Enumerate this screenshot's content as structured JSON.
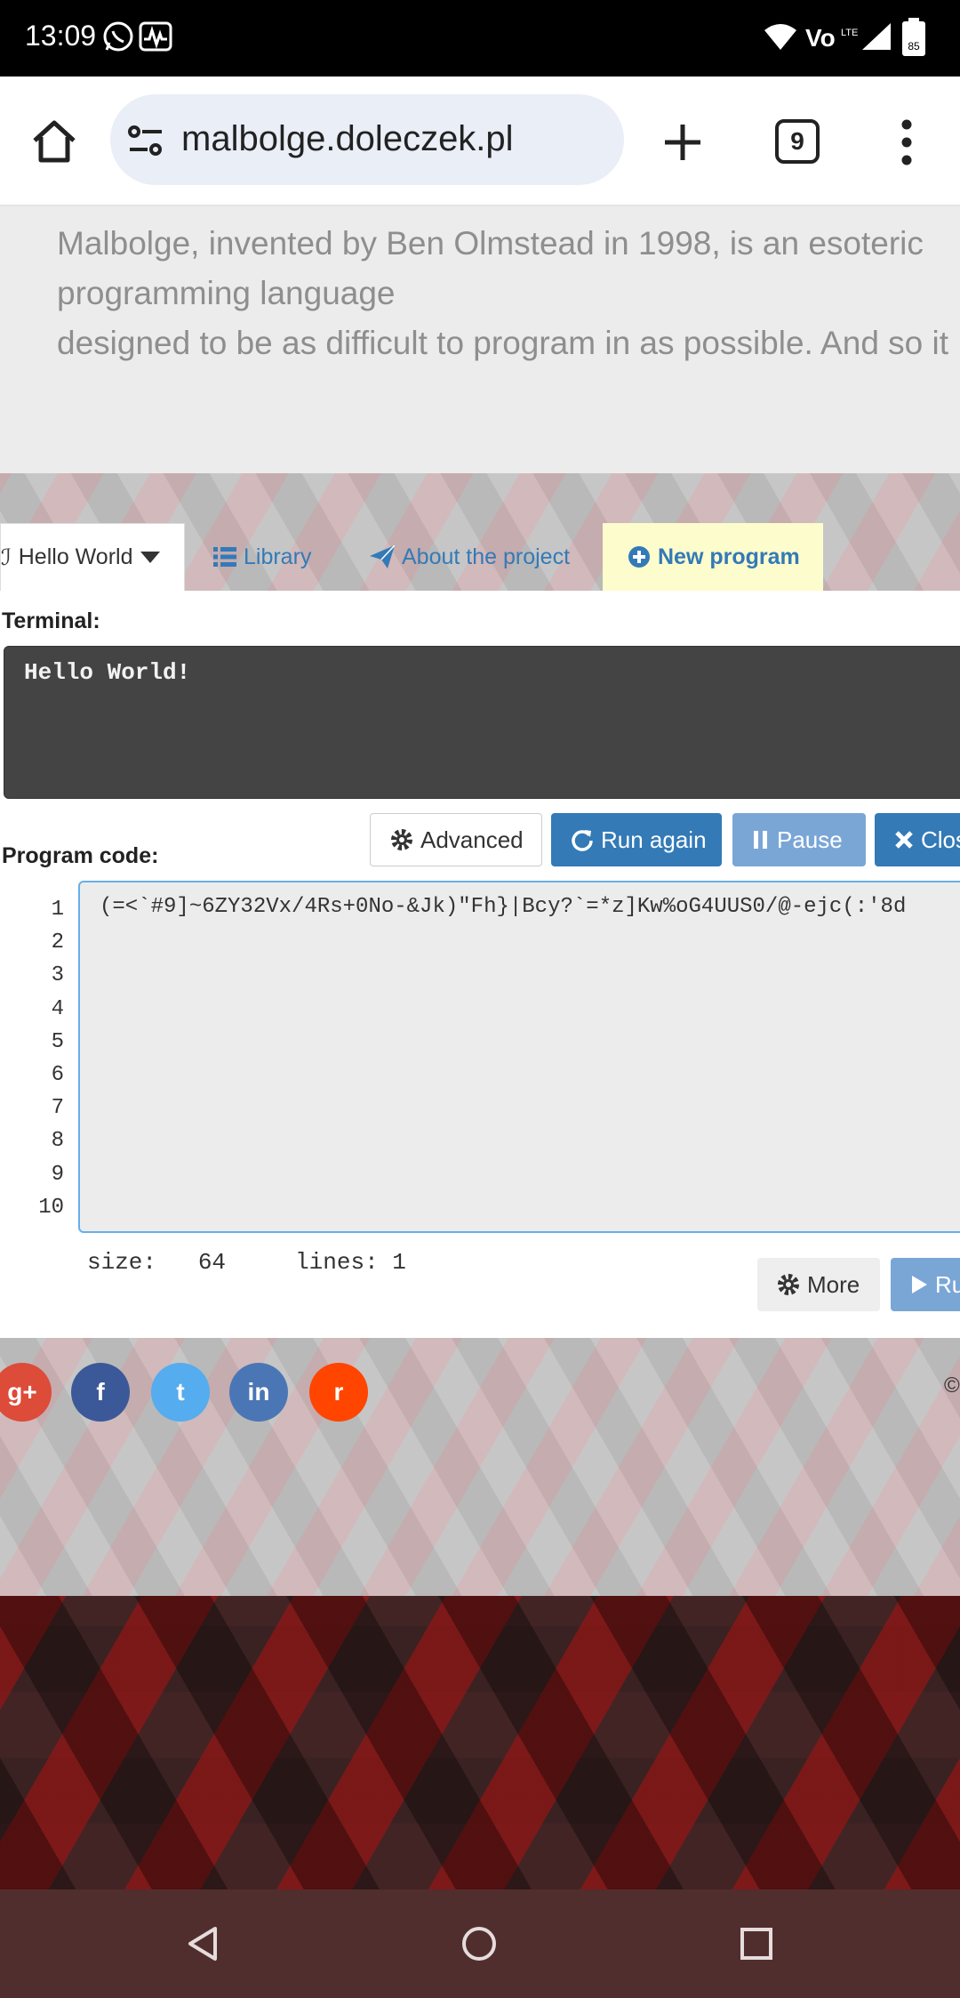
{
  "status_bar": {
    "time": "13:09",
    "battery": "85",
    "icons": [
      "whatsapp-icon",
      "activity-icon",
      "wifi-icon",
      "volte-icon",
      "signal-icon",
      "battery-icon"
    ]
  },
  "browser": {
    "url": "malbolge.doleczek.pl",
    "tab_count": "9"
  },
  "intro": {
    "text": "Malbolge, invented by Ben Olmstead in 1998, is an esoteric\nprogramming language\ndesigned to be as difficult to program in as possible. And so it"
  },
  "tabs": {
    "hello": "Hello World",
    "library": "Library",
    "about": "About the project",
    "new_program": "New program"
  },
  "terminal": {
    "label": "Terminal:",
    "output": "Hello World!"
  },
  "toolbar": {
    "advanced": "Advanced",
    "run_again": "Run again",
    "pause": "Pause",
    "close": "Clos"
  },
  "editor": {
    "label": "Program code:",
    "line_numbers": [
      "1",
      "2",
      "3",
      "4",
      "5",
      "6",
      "7",
      "8",
      "9",
      "10"
    ],
    "code": "(=<`#9]~6ZY32Vx/4Rs+0No-&Jk)\"Fh}|Bcy?`=*z]Kw%oG4UUS0/@-ejc(:'8d",
    "size_label": "size:",
    "size_value": "64",
    "lines_label": "lines:",
    "lines_value": "1"
  },
  "actions": {
    "more": "More",
    "run": "Ru"
  },
  "social": {
    "gplus": "g+",
    "facebook": "f",
    "twitter": "t",
    "linkedin": "in",
    "reddit": "r",
    "copyright": "©"
  },
  "colors": {
    "accent": "#337ab7",
    "accent_disabled": "#7aa6d6",
    "terminal_bg": "#444444",
    "new_tab_bg": "#fdfccc",
    "nav_bar": "#512e2e"
  }
}
